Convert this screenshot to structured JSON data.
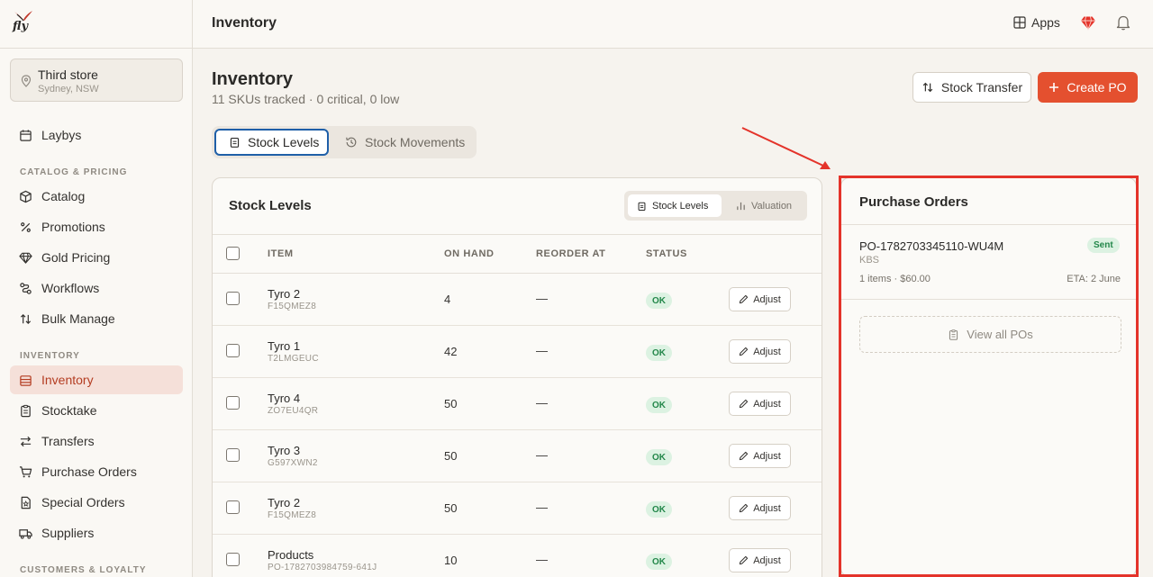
{
  "brand": {
    "logo_text": "fly"
  },
  "store": {
    "name": "Third store",
    "location": "Sydney, NSW"
  },
  "sidebar": {
    "laybys": "Laybys",
    "section_catalog": "CATALOG & PRICING",
    "catalog": "Catalog",
    "promotions": "Promotions",
    "gold_pricing": "Gold Pricing",
    "workflows": "Workflows",
    "bulk_manage": "Bulk Manage",
    "section_inventory": "INVENTORY",
    "inventory": "Inventory",
    "stocktake": "Stocktake",
    "transfers": "Transfers",
    "purchase_orders": "Purchase Orders",
    "special_orders": "Special Orders",
    "suppliers": "Suppliers",
    "section_customers": "CUSTOMERS & LOYALTY"
  },
  "topbar": {
    "title": "Inventory",
    "apps_label": "Apps"
  },
  "page": {
    "title": "Inventory",
    "subtitle": "11 SKUs tracked · 0 critical, 0 low",
    "stock_transfer_label": "Stock Transfer",
    "create_po_label": "Create PO"
  },
  "tabs": {
    "stock_levels": "Stock Levels",
    "stock_movements": "Stock Movements"
  },
  "stock_card": {
    "title": "Stock Levels",
    "seg_stock_levels": "Stock Levels",
    "seg_valuation": "Valuation",
    "columns": {
      "item": "ITEM",
      "on_hand": "ON HAND",
      "reorder_at": "REORDER AT",
      "status": "STATUS"
    },
    "adjust_label": "Adjust",
    "rows": [
      {
        "name": "Tyro 2",
        "sku": "F15QMEZ8",
        "on_hand": "4",
        "reorder": "—",
        "status": "OK"
      },
      {
        "name": "Tyro 1",
        "sku": "T2LMGEUC",
        "on_hand": "42",
        "reorder": "—",
        "status": "OK"
      },
      {
        "name": "Tyro 4",
        "sku": "ZO7EU4QR",
        "on_hand": "50",
        "reorder": "—",
        "status": "OK"
      },
      {
        "name": "Tyro 3",
        "sku": "G597XWN2",
        "on_hand": "50",
        "reorder": "—",
        "status": "OK"
      },
      {
        "name": "Tyro 2",
        "sku": "F15QMEZ8",
        "on_hand": "50",
        "reorder": "—",
        "status": "OK"
      },
      {
        "name": "Products",
        "sku": "PO-1782703984759-641J",
        "on_hand": "10",
        "reorder": "—",
        "status": "OK"
      }
    ]
  },
  "purchase_orders": {
    "title": "Purchase Orders",
    "order": {
      "number": "PO-1782703345110-WU4M",
      "status": "Sent",
      "supplier": "KBS",
      "summary": "1 items · $60.00",
      "eta": "ETA: 2 June"
    },
    "view_all_label": "View all POs"
  },
  "colors": {
    "accent": "#e4502f",
    "highlight": "#e4332a",
    "active_tab_border": "#1f5fa8",
    "ok_badge": "#dcf2e2"
  }
}
